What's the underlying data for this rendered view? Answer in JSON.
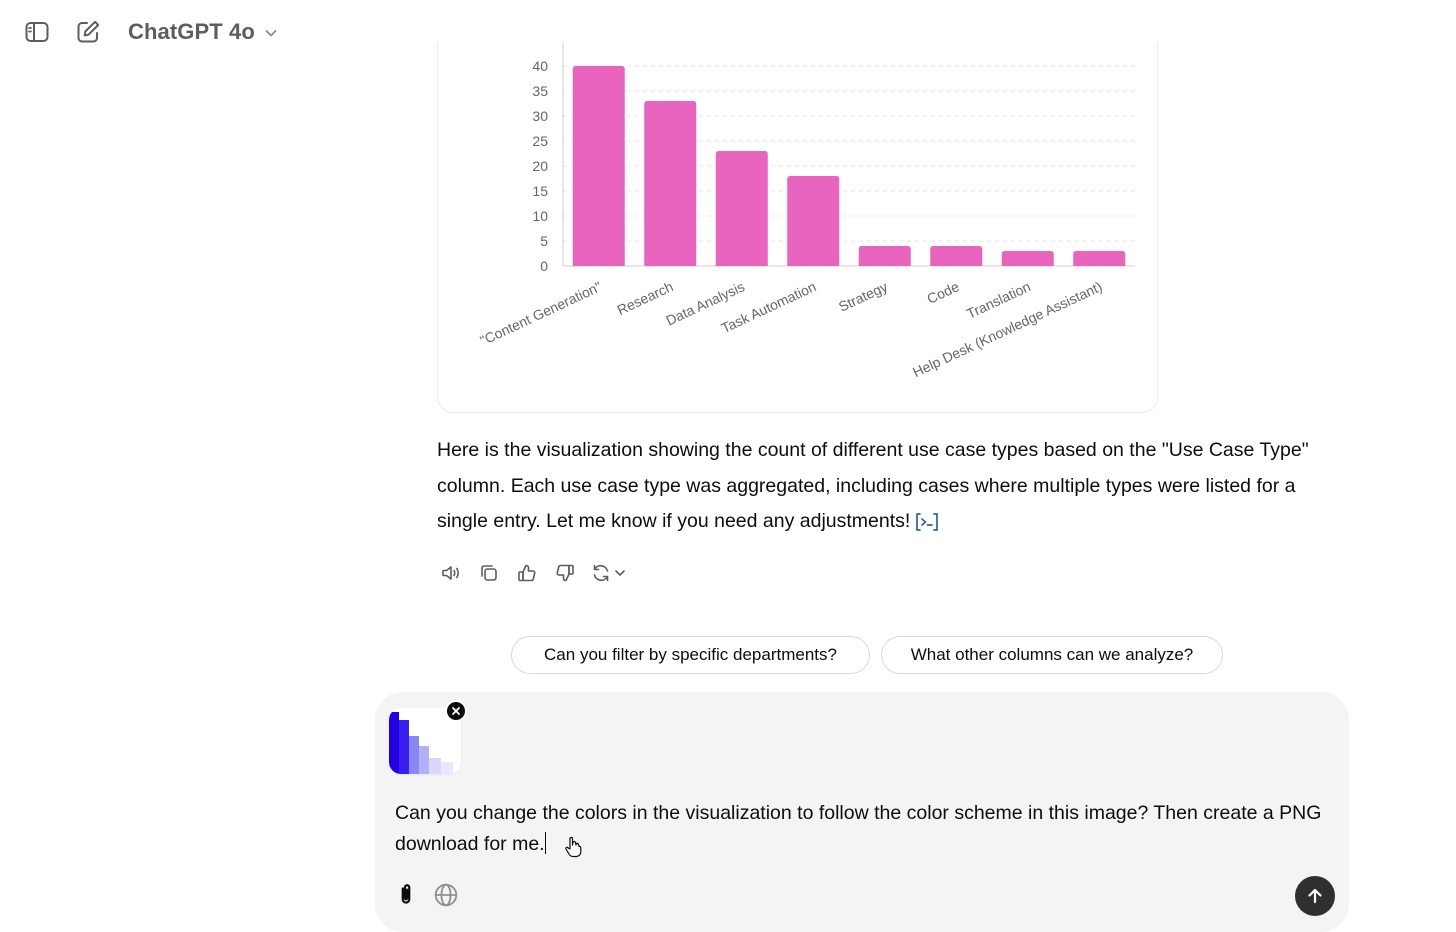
{
  "header": {
    "sidebar_toggle_icon": "sidebar-toggle-icon",
    "new_chat_icon": "compose-icon",
    "model_name": "ChatGPT 4o",
    "model_dropdown_icon": "chevron-down-icon"
  },
  "chart_data": {
    "type": "bar",
    "categories": [
      "\"Content Generation\"",
      "Research",
      "Data Analysis",
      "Task Automation",
      "Strategy",
      "Code",
      "Translation",
      "Help Desk (Knowledge Assistant)"
    ],
    "values": [
      40,
      33,
      23,
      18,
      4,
      4,
      3,
      3
    ],
    "y_ticks": [
      "0",
      "5",
      "10",
      "15",
      "20",
      "25",
      "30",
      "35",
      "40"
    ],
    "ylim": [
      0,
      40
    ],
    "bar_color": "#e964bf",
    "grid": true,
    "title": "",
    "xlabel": "",
    "ylabel": ""
  },
  "message": {
    "text": "Here is the visualization showing the count of different use case types based on the \"Use Case Type\" column. Each use case type was aggregated, including cases where multiple types were listed for a single entry. Let me know if you need any adjustments!",
    "citation_icon": "code-bracket-icon",
    "link_color": "#2964aa"
  },
  "actions": {
    "read_aloud_icon": "speaker-icon",
    "copy_icon": "copy-icon",
    "good_icon": "thumbs-up-icon",
    "bad_icon": "thumbs-down-icon",
    "regenerate_icon": "refresh-icon"
  },
  "suggestions": [
    "Can you filter by specific departments?",
    "What other columns can we analyze?"
  ],
  "composer": {
    "prompt_text": "Can you change the colors in the visualization to follow the color scheme in this image? Then create a PNG download for me.",
    "attachment_icon": "paperclip-icon",
    "web_icon": "globe-icon",
    "send_icon": "arrow-up-icon",
    "thumbnail_colors": [
      "#2200e6",
      "#5a52f0",
      "#a9a6f7",
      "#d9d8fb"
    ],
    "send_bg": "#2f2f2f"
  }
}
